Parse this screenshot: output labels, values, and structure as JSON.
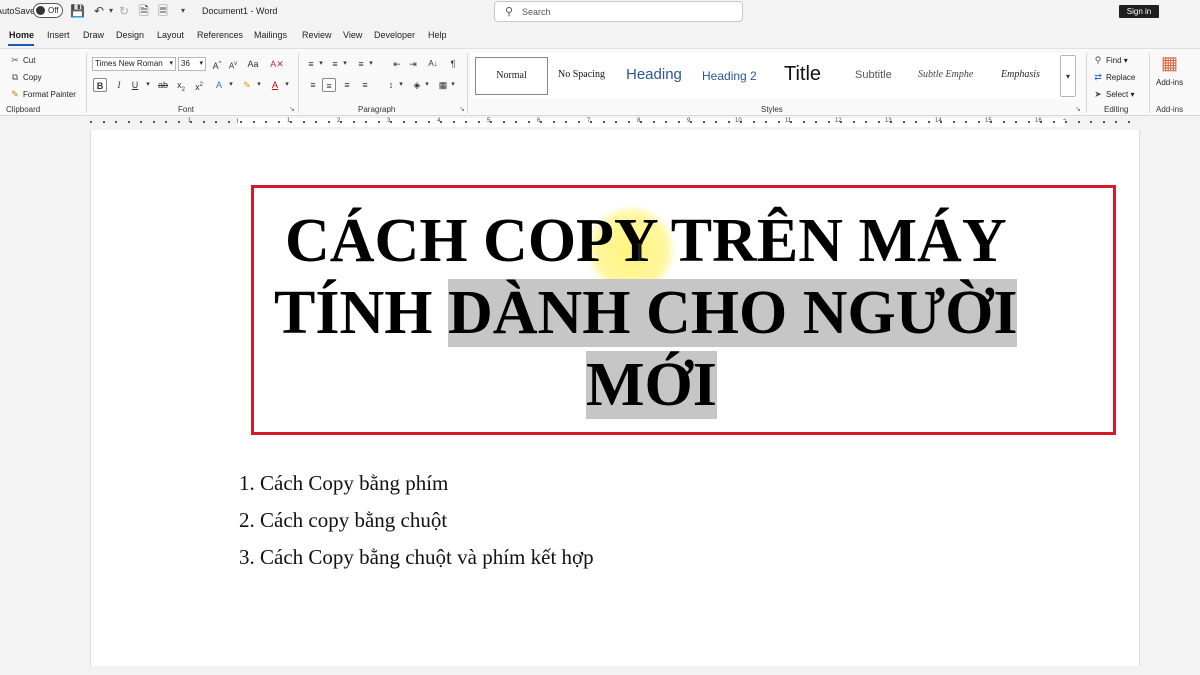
{
  "titlebar": {
    "autosave_label": "AutoSave",
    "toggle_state": "Off",
    "doc_title": "Document1  -  Word",
    "search_placeholder": "Search",
    "signin_label": "Sign in"
  },
  "tabs": [
    {
      "label": "Home",
      "active": true
    },
    {
      "label": "Insert"
    },
    {
      "label": "Draw"
    },
    {
      "label": "Design"
    },
    {
      "label": "Layout"
    },
    {
      "label": "References"
    },
    {
      "label": "Mailings"
    },
    {
      "label": "Review"
    },
    {
      "label": "View"
    },
    {
      "label": "Developer"
    },
    {
      "label": "Help"
    }
  ],
  "ribbon": {
    "clipboard": {
      "cut": "Cut",
      "copy": "Copy",
      "format_painter": "Format Painter",
      "label": "Clipboard"
    },
    "font": {
      "name": "Times New Roman",
      "size": "36",
      "label": "Font"
    },
    "paragraph": {
      "label": "Paragraph"
    },
    "styles": {
      "items": [
        "Normal",
        "No Spacing",
        "Heading",
        "Heading 2",
        "Title",
        "Subtitle",
        "Subtle Emphe",
        "Emphasis"
      ],
      "label": "Styles"
    },
    "editing": {
      "find": "Find",
      "replace": "Replace",
      "select": "Select",
      "label": "Editing"
    },
    "addins": {
      "button": "Add-ins",
      "label": "Add-ins"
    }
  },
  "ruler": {
    "numbers": [
      "1",
      "1",
      "2",
      "3",
      "4",
      "5",
      "6",
      "7",
      "8",
      "9",
      "10",
      "11",
      "12",
      "13",
      "14",
      "15",
      "16"
    ]
  },
  "document": {
    "title_lines": [
      "CÁCH COPY TRÊN MÁY",
      "TÍNH ",
      "DÀNH CHO NGƯỜI",
      "MỚI"
    ],
    "list": [
      "1. Cách Copy bằng phím",
      "2. Cách copy bằng chuột",
      "3. Cách Copy bằng chuột và phím kết hợp"
    ]
  },
  "colors": {
    "accent": "#185abd",
    "frame": "#d11c2a",
    "highlight": "#c6c6c6"
  }
}
